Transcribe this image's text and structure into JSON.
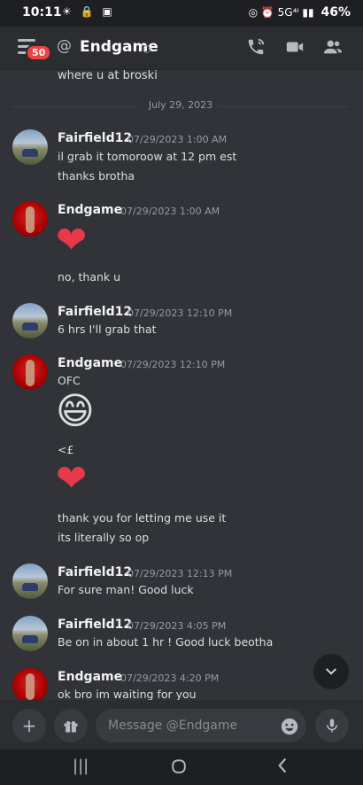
{
  "status_bar": {
    "time": "10:11",
    "left_icons": "☀ 🔒 ▣",
    "right_icons": "◎ ⏰ 5G⁴ᴵ ▮▮",
    "battery": "46%"
  },
  "header": {
    "unread_badge": "50",
    "channel_prefix": "@",
    "title": "Endgame",
    "icons": [
      "menu-icon",
      "voice-call-icon",
      "video-call-icon",
      "members-icon"
    ]
  },
  "messages_area": {
    "previous_message": "where u at broski",
    "date_divider": "July 29, 2023",
    "groups": [
      {
        "author": "Fairfield12",
        "timestamp": "07/29/2023 1:00 AM",
        "lines": [
          "il grab it tomoroow at 12 pm est",
          "thanks brotha"
        ]
      },
      {
        "author": "Endgame",
        "timestamp": "07/29/2023 1:00 AM",
        "emoji": "❤",
        "lines": [
          "no, thank u"
        ]
      },
      {
        "author": "Fairfield12",
        "timestamp": "07/29/2023 12:10 PM",
        "lines": [
          "6 hrs I'll grab that"
        ]
      },
      {
        "author": "Endgame",
        "timestamp": "07/29/2023 12:10 PM",
        "lines": [
          "OFC",
          "<£",
          "thank you for letting me use it",
          "its literally so op"
        ],
        "emojis": [
          "😄",
          "❤"
        ]
      },
      {
        "author": "Fairfield12",
        "timestamp": "07/29/2023 12:13 PM",
        "lines": [
          "For sure man! Good luck"
        ]
      },
      {
        "author": "Fairfield12",
        "timestamp": "07/29/2023 4:05 PM",
        "lines": [
          "Be on in about 1 hr ! Good luck beotha"
        ]
      },
      {
        "author": "Endgame",
        "timestamp": "07/29/2023 4:20 PM",
        "lines": [
          "ok bro im waiting for you"
        ]
      }
    ]
  },
  "composer": {
    "placeholder": "Message @Endgame",
    "value": ""
  },
  "colors": {
    "background": "#313338",
    "header": "#2b2d31",
    "badge": "#f23f43",
    "heart": "#e8394a"
  }
}
